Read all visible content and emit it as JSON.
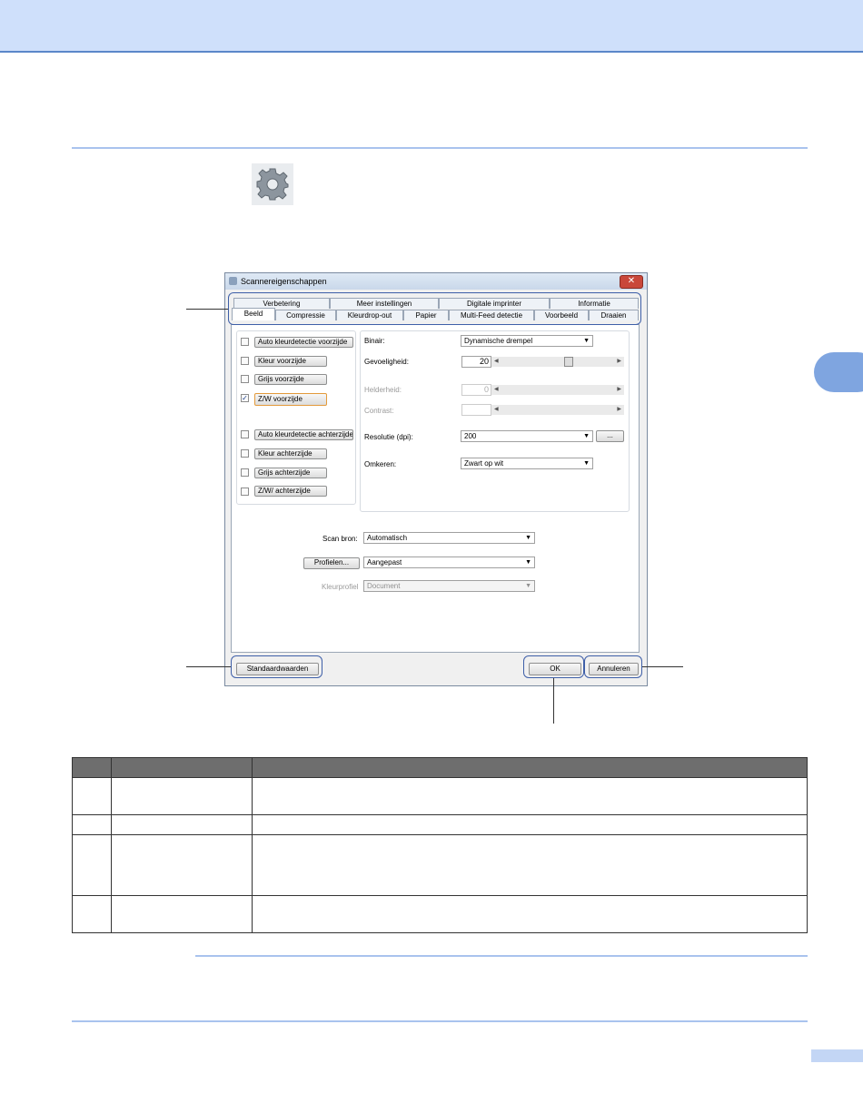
{
  "dialog": {
    "title": "Scannereigenschappen",
    "close_glyph": "✕",
    "tabs_top": [
      "Verbetering",
      "Meer instellingen",
      "Digitale imprinter",
      "Informatie"
    ],
    "tabs_bottom": [
      "Beeld",
      "Compressie",
      "Kleurdrop-out",
      "Papier",
      "Multi-Feed detectie",
      "Voorbeeld",
      "Draaien"
    ],
    "selected_tab": "Beeld",
    "image_types": [
      {
        "label": "Auto kleurdetectie voorzijde",
        "checked": false
      },
      {
        "label": "Kleur voorzijde",
        "checked": false
      },
      {
        "label": "Grijs voorzijde",
        "checked": false
      },
      {
        "label": "Z/W voorzijde",
        "checked": true
      },
      {
        "label": "Auto kleurdetectie achterzijde",
        "checked": false
      },
      {
        "label": "Kleur achterzijde",
        "checked": false
      },
      {
        "label": "Grijs achterzijde",
        "checked": false
      },
      {
        "label": "Z/W/ achterzijde",
        "checked": false
      }
    ],
    "check_glyph": "✓",
    "binair_label": "Binair:",
    "binair_value": "Dynamische drempel",
    "gevoeligheid_label": "Gevoeligheid:",
    "gevoeligheid_value": "20",
    "gevoeligheid_level": 0.6,
    "helderheid_label": "Helderheid:",
    "helderheid_value": "0",
    "contrast_label": "Contrast:",
    "contrast_value": "",
    "resolutie_label": "Resolutie (dpi):",
    "resolutie_value": "200",
    "ellipsis_button": "...",
    "omkeren_label": "Omkeren:",
    "omkeren_value": "Zwart op wit",
    "scanbron_label": "Scan bron:",
    "scanbron_value": "Automatisch",
    "profielen_button": "Profielen...",
    "profielen_value": "Aangepast",
    "kleurprofiel_label": "Kleurprofiel",
    "kleurprofiel_value": "Document",
    "standaard_button": "Standaardwaarden",
    "ok_button": "OK",
    "annuleren_button": "Annuleren",
    "arrow_down": "▼",
    "arrow_left": "◀",
    "arrow_right": "▶"
  },
  "colors": {
    "header_band": "#cfe0fb",
    "rule": "#a9c3ee",
    "accent": "#7fa5e0",
    "table_header": "#6e6e6e",
    "callout": "#3e5fa8"
  }
}
